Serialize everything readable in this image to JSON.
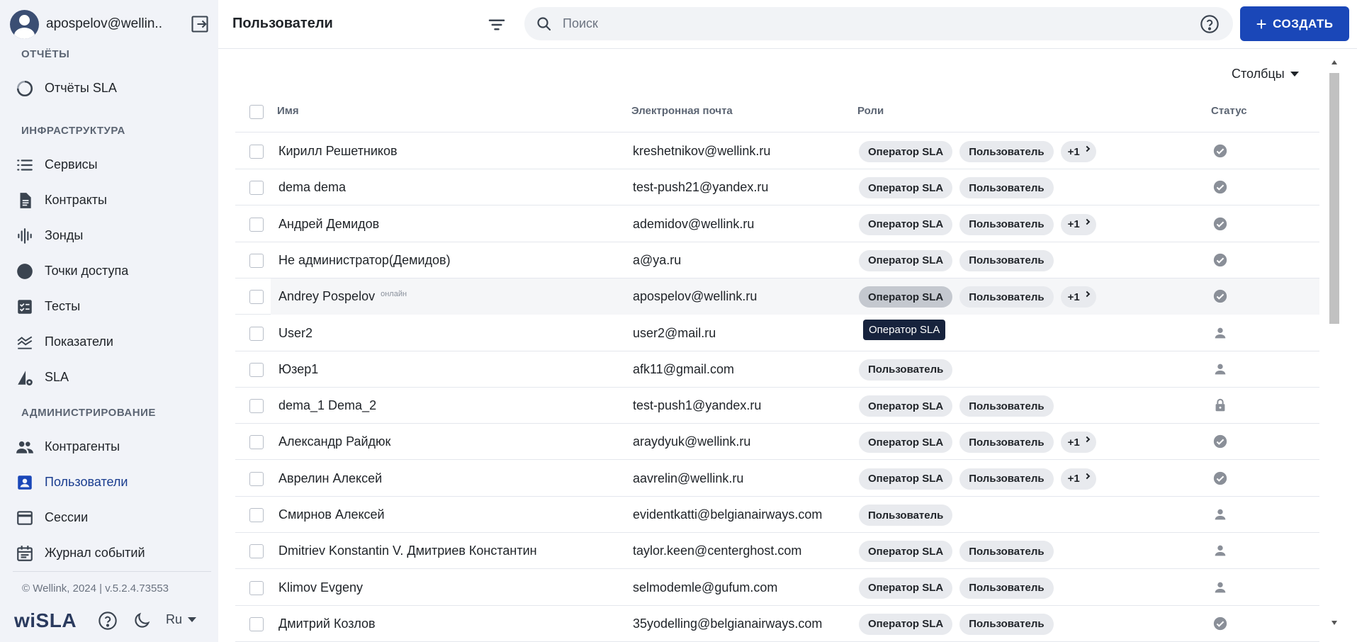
{
  "user": {
    "email": "apospelov@wellin..."
  },
  "sidebar": {
    "sections": [
      {
        "title": "ОТЧЁТЫ",
        "items": [
          {
            "label": "Отчёты SLA",
            "icon": "circle-progress-icon"
          }
        ]
      },
      {
        "title": "ИНФРАСТРУКТУРА",
        "items": [
          {
            "label": "Сервисы",
            "icon": "list-icon"
          },
          {
            "label": "Контракты",
            "icon": "document-icon"
          },
          {
            "label": "Зонды",
            "icon": "waveform-icon"
          },
          {
            "label": "Точки доступа",
            "icon": "dot-icon"
          },
          {
            "label": "Тесты",
            "icon": "checklist-icon"
          },
          {
            "label": "Показатели",
            "icon": "chart-lines-icon"
          },
          {
            "label": "SLA",
            "icon": "sla-gear-icon"
          }
        ]
      },
      {
        "title": "АДМИНИСТРИРОВАНИЕ",
        "items": [
          {
            "label": "Контрагенты",
            "icon": "people-icon"
          },
          {
            "label": "Пользователи",
            "icon": "user-card-icon",
            "active": true
          },
          {
            "label": "Сессии",
            "icon": "window-icon"
          },
          {
            "label": "Журнал событий",
            "icon": "calendar-icon"
          }
        ]
      }
    ],
    "copyright": "© Wellink, 2024 | v.5.2.4.73553",
    "logo": "wiSLA",
    "language": "Ru"
  },
  "header": {
    "title": "Пользователи",
    "search_placeholder": "Поиск",
    "create_label": "СОЗДАТЬ"
  },
  "main": {
    "columns_label": "Столбцы",
    "headers": {
      "name": "Имя",
      "email": "Электронная почта",
      "roles": "Роли",
      "status": "Статус"
    },
    "online_label": "онлайн",
    "tooltip": "Оператор SLA",
    "rows": [
      {
        "name": "Кирилл Решетников",
        "email": "kreshetnikov@wellink.ru",
        "roles": [
          "Оператор SLA",
          "Пользователь"
        ],
        "more": "+1",
        "status": "active"
      },
      {
        "name": "dema dema",
        "email": "test-push21@yandex.ru",
        "roles": [
          "Оператор SLA",
          "Пользователь"
        ],
        "status": "active"
      },
      {
        "name": "Андрей Демидов",
        "email": "ademidov@wellink.ru",
        "roles": [
          "Оператор SLA",
          "Пользователь"
        ],
        "more": "+1",
        "status": "active"
      },
      {
        "name": "Не администратор(Демидов)",
        "email": "a@ya.ru",
        "roles": [
          "Оператор SLA",
          "Пользователь"
        ],
        "status": "active"
      },
      {
        "name": "Andrey Pospelov",
        "email": "apospelov@wellink.ru",
        "roles": [
          "Оператор SLA",
          "Пользователь"
        ],
        "more": "+1",
        "status": "active",
        "online": true,
        "hovered": true
      },
      {
        "name": "User2",
        "email": "user2@mail.ru",
        "roles": [],
        "status": "user"
      },
      {
        "name": "Юзер1",
        "email": "afk11@gmail.com",
        "roles": [
          "Пользователь"
        ],
        "status": "user"
      },
      {
        "name": "dema_1 Dema_2",
        "email": "test-push1@yandex.ru",
        "roles": [
          "Оператор SLA",
          "Пользователь"
        ],
        "status": "locked"
      },
      {
        "name": "Александр Райдюк",
        "email": "araydyuk@wellink.ru",
        "roles": [
          "Оператор SLA",
          "Пользователь"
        ],
        "more": "+1",
        "status": "active"
      },
      {
        "name": "Аврелин Алексей",
        "email": "aavrelin@wellink.ru",
        "roles": [
          "Оператор SLA",
          "Пользователь"
        ],
        "more": "+1",
        "status": "active"
      },
      {
        "name": "Смирнов Алексей",
        "email": "evidentkatti@belgianairways.com",
        "roles": [
          "Пользователь"
        ],
        "status": "user"
      },
      {
        "name": "Dmitriev Konstantin V. Дмитриев Константин",
        "email": "taylor.keen@centerghost.com",
        "roles": [
          "Оператор SLA",
          "Пользователь"
        ],
        "status": "user"
      },
      {
        "name": "Klimov Evgeny",
        "email": "selmodemle@gufum.com",
        "roles": [
          "Оператор SLA",
          "Пользователь"
        ],
        "status": "user"
      },
      {
        "name": "Дмитрий Козлов",
        "email": "35yodelling@belgianairways.com",
        "roles": [
          "Оператор SLA",
          "Пользователь"
        ],
        "status": "active"
      }
    ]
  },
  "colors": {
    "accent": "#1a47b8",
    "sidebar_bg": "#f1f3f8",
    "active_nav": "#1a3d8f",
    "status_icon": "#8a8f98"
  }
}
